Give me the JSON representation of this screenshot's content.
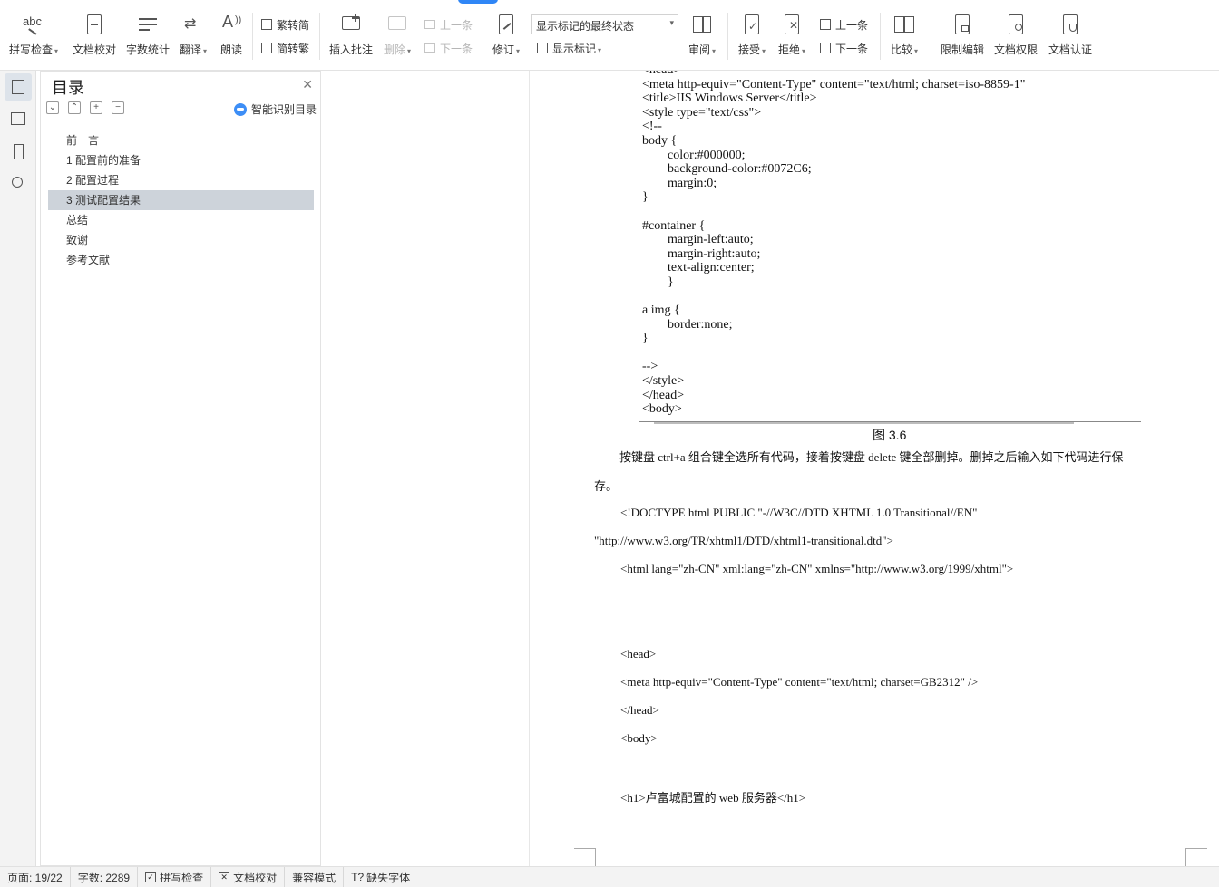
{
  "ribbon": {
    "spell_check": "拼写检查",
    "doc_proofread": "文档校对",
    "word_count": "字数统计",
    "translate": "翻译",
    "read_aloud": "朗读",
    "trad_to_simp": "繁转简",
    "simp_to_trad": "简转繁",
    "insert_comment": "插入批注",
    "delete": "删除",
    "prev_item": "上一条",
    "next_item": "下一条",
    "revise": "修订",
    "markup_state": "显示标记的最终状态",
    "show_markup": "显示标记",
    "review": "审阅",
    "accept": "接受",
    "reject": "拒绝",
    "prev_change": "上一条",
    "next_change": "下一条",
    "compare": "比较",
    "restrict_edit": "限制编辑",
    "doc_permission": "文档权限",
    "doc_certify": "文档认证",
    "abc": "abc"
  },
  "toc": {
    "title": "目录",
    "smart_label": "智能识别目录",
    "items": [
      {
        "label": "前　言"
      },
      {
        "label": "1 配置前的准备"
      },
      {
        "label": "2 配置过程"
      },
      {
        "label": "3 测试配置结果"
      },
      {
        "label": "总结"
      },
      {
        "label": "致谢"
      },
      {
        "label": "参考文献"
      }
    ],
    "active_index": 3
  },
  "document": {
    "code_lines": [
      "<head>",
      "<meta http-equiv=\"Content-Type\" content=\"text/html; charset=iso-8859-1\"",
      "<title>IIS Windows Server</title>",
      "<style type=\"text/css\">",
      "<!--",
      "body {",
      "        color:#000000;",
      "        background-color:#0072C6;",
      "        margin:0;",
      "}",
      "",
      "#container {",
      "        margin-left:auto;",
      "        margin-right:auto;",
      "        text-align:center;",
      "        }",
      "",
      "a img {",
      "        border:none;",
      "}",
      "",
      "-->",
      "</style>",
      "</head>",
      "<body>"
    ],
    "caption": "图 3.6",
    "para1_line1": "按键盘 ctrl+a 组合键全选所有代码，接着按键盘 delete 键全部删掉。删掉之后输入如下代码进行保",
    "para1_line2": "存。",
    "doctype_line1": "<!DOCTYPE      html      PUBLIC      \"-//W3C//DTD      XHTML      1.0      Transitional//EN\"",
    "doctype_line2": "\"http://www.w3.org/TR/xhtml1/DTD/xhtml1-transitional.dtd\">",
    "html_line": "<html lang=\"zh-CN\" xml:lang=\"zh-CN\" xmlns=\"http://www.w3.org/1999/xhtml\">",
    "head_open": "<head>",
    "meta_line": "<meta http-equiv=\"Content-Type\" content=\"text/html; charset=GB2312\" />",
    "head_close": "</head>",
    "body_open": "<body>",
    "h1_line": "<h1>卢富城配置的 web 服务器</h1>"
  },
  "status": {
    "page": "页面: 19/22",
    "words": "字数: 2289",
    "spell_check": "拼写检查",
    "doc_proofread": "文档校对",
    "compat_mode": "兼容模式",
    "missing_font": "缺失字体"
  }
}
